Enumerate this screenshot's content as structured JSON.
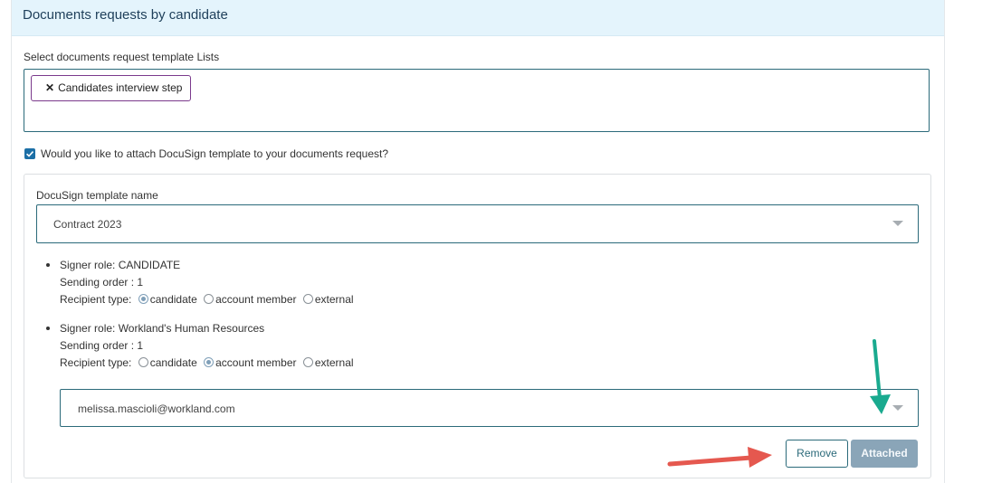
{
  "panel": {
    "title": "Documents requests by candidate"
  },
  "template_list": {
    "label": "Select documents request template Lists",
    "chips": [
      {
        "remove_glyph": "✕",
        "label": "Candidates interview step"
      }
    ]
  },
  "docusign_toggle": {
    "checked": true,
    "label": "Would you like to attach DocuSign template to your documents request?"
  },
  "docusign": {
    "template_label": "DocuSign template name",
    "template_value": "Contract 2023",
    "signers": [
      {
        "role_line": "Signer role: CANDIDATE",
        "order_line": "Sending order : 1",
        "recipient_label": "Recipient type:",
        "options": [
          "candidate",
          "account member",
          "external"
        ],
        "selected": "candidate"
      },
      {
        "role_line": "Signer role: Workland's Human Resources",
        "order_line": "Sending order : 1",
        "recipient_label": "Recipient type:",
        "options": [
          "candidate",
          "account member",
          "external"
        ],
        "selected": "account member"
      }
    ],
    "member_email": "melissa.mascioli@workland.com",
    "remove_label": "Remove",
    "attached_label": "Attached"
  },
  "annotation_colors": {
    "teal_arrow": "#1aaa8f",
    "red_arrow": "#e5584f"
  }
}
